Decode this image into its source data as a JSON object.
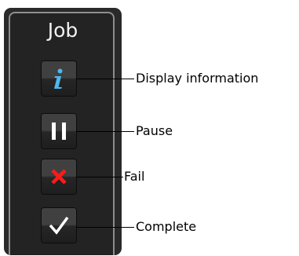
{
  "panel": {
    "title": "Job"
  },
  "buttons": [
    {
      "id": "info",
      "icon": "info-icon",
      "label": "Display information",
      "icon_color": "#4db8ee"
    },
    {
      "id": "pause",
      "icon": "pause-icon",
      "label": "Pause",
      "icon_color": "#ffffff"
    },
    {
      "id": "fail",
      "icon": "close-x-icon",
      "label": "Fail",
      "icon_color": "#ff1a1a"
    },
    {
      "id": "complete",
      "icon": "checkmark-icon",
      "label": "Complete",
      "icon_color": "#ffffff"
    }
  ]
}
